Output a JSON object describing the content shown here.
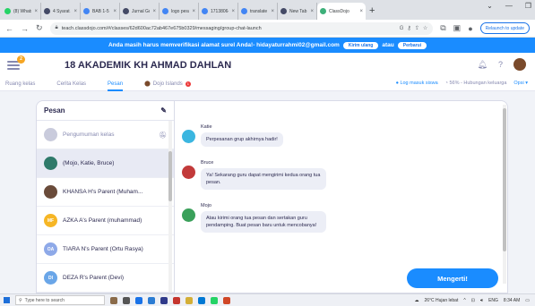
{
  "browser": {
    "tabs": [
      {
        "title": "(8) WhatsA",
        "color": "#25d366"
      },
      {
        "title": "4 Syarat A",
        "color": "#444a66"
      },
      {
        "title": "BAB 1-5 Jur",
        "color": "#4285f4"
      },
      {
        "title": "Jurnal Gur",
        "color": "#444a66"
      },
      {
        "title": "logo pesa",
        "color": "#4285f4"
      },
      {
        "title": "17138064",
        "color": "#4285f4"
      },
      {
        "title": "translate",
        "color": "#4285f4"
      },
      {
        "title": "New Tab",
        "color": "#444a66"
      },
      {
        "title": "ClassDojo",
        "color": "#3db07a",
        "active": true
      }
    ],
    "new_tab": "+",
    "url": "teach.classdojo.com/#/classes/62d600ac72ab467e675b0329/messaging/group-chat-launch",
    "relaunch_label": "Relaunch to update"
  },
  "banner": {
    "text": "Anda masih harus memverifikasi alamat surel Anda!- hidayaturrahmi02@gmail.com",
    "resend_label": "Kirim ulang",
    "or_label": "atau",
    "change_label": "Perbarui"
  },
  "header": {
    "class_name": "18 AKADEMIK KH AHMAD DAHLAN",
    "badge": "2"
  },
  "subnav": {
    "items": [
      {
        "label": "Ruang kelas"
      },
      {
        "label": "Cerita Kelas"
      },
      {
        "label": "Pesan",
        "active": true
      },
      {
        "label": "Dojo Islands",
        "badge": "1"
      }
    ],
    "student_login": "Log masuk siswa",
    "family_connections": "56% - Hubungan keluarga",
    "options": "Opsi"
  },
  "chat_panel": {
    "title": "Pesan",
    "chats": [
      {
        "name": "Pengumuman kelas",
        "muted": true,
        "avatar_color": "#c9cbdc",
        "initials": ""
      },
      {
        "name": "(Mojo, Katie, Bruce)",
        "selected": true,
        "avatar_color": "#2f7a6a",
        "initials": ""
      },
      {
        "name": "KHANSA H's Parent (Muham...",
        "avatar_color": "#6a4b3a",
        "initials": ""
      },
      {
        "name": "AZKA A's Parent (muhammad)",
        "avatar_color": "#f6b625",
        "initials": "MF"
      },
      {
        "name": "TIARA N's Parent (Ortu Rasya)",
        "avatar_color": "#8ea9e8",
        "initials": "OA"
      },
      {
        "name": "DEZA R's Parent (Devi)",
        "avatar_color": "#6aa6e8",
        "initials": "DI"
      }
    ]
  },
  "conversation": {
    "messages": [
      {
        "sender": "Katie",
        "text": "Perpesanan grup akhirnya hadir!",
        "avatar_color": "#3bb6e0"
      },
      {
        "sender": "Bruce",
        "text": "Ya! Sekarang guru dapat mengirimi kedua orang tua pesan.",
        "avatar_color": "#c23a3a"
      },
      {
        "sender": "Mojo",
        "text": "Atau kirimi orang tua pesan dan sertakan guru pendamping. Buat pesan baru untuk mencobanya!",
        "avatar_color": "#3aa05a"
      }
    ],
    "send_label": "Mengerti!"
  },
  "taskbar": {
    "search_placeholder": "Type here to search",
    "weather": "26°C Hujan lebat",
    "lang": "ENG",
    "time": "8:34 AM"
  }
}
